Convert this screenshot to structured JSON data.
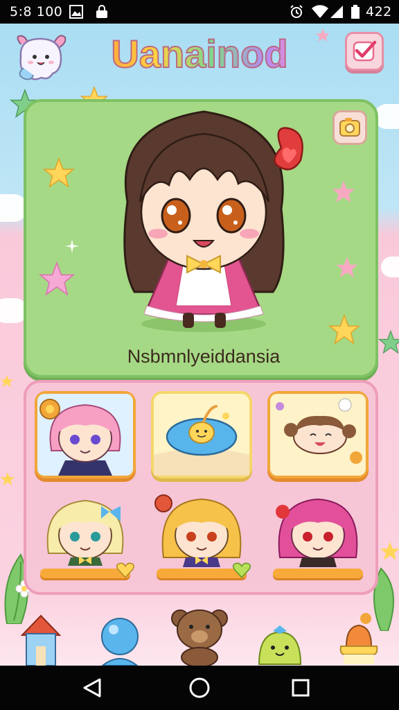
{
  "status_bar": {
    "time": "5:8 100",
    "battery_text": "422",
    "icons": [
      "gallery-icon",
      "lock-icon",
      "alarm-icon",
      "wifi-icon",
      "signal-icon",
      "battery-icon"
    ]
  },
  "header": {
    "title": "Uanainod",
    "mascot_icon": "ghost-mascot-icon",
    "action_icon": "checkmark-icon"
  },
  "hero": {
    "character_name": "Nsbmnlyeiddansia",
    "corner_icon": "camera-icon",
    "background_color": "#a6d985"
  },
  "collection": {
    "items": [
      {
        "id": "pink-hair-girl",
        "style": "framed"
      },
      {
        "id": "blue-fish-dish",
        "style": "framed"
      },
      {
        "id": "smiling-face-food",
        "style": "framed"
      },
      {
        "id": "blonde-teal-eyes-girl",
        "style": "bar"
      },
      {
        "id": "golden-hair-girl",
        "style": "bar"
      },
      {
        "id": "magenta-hair-girl",
        "style": "bar"
      }
    ]
  },
  "dock": {
    "items": [
      "house-icon",
      "blue-balloon-icon",
      "bear-icon",
      "slime-icon",
      "cake-icon"
    ]
  },
  "nav": {
    "items": [
      "back-icon",
      "home-icon",
      "recents-icon"
    ]
  },
  "colors": {
    "accent_pink": "#ee9dbb",
    "accent_orange": "#f2a63a",
    "card_green": "#a6d985"
  }
}
